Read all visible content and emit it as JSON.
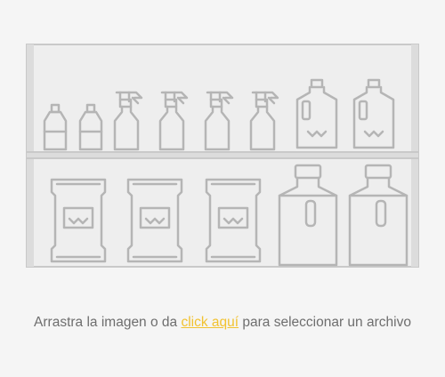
{
  "colors": {
    "background": "#f5f5f5",
    "shelf_fill": "#eeeeee",
    "shelf_stroke": "#c9c9c9",
    "product_stroke": "#b5b5b5",
    "text": "#6e6e6e",
    "link": "#f2c230"
  },
  "illustration": {
    "icon": "shelf-with-cleaning-products-icon",
    "top_shelf": {
      "small_bottles": 2,
      "spray_bottles": 4,
      "jugs": 2
    },
    "bottom_shelf": {
      "bags": 3,
      "detergent_bottles": 2
    }
  },
  "upload": {
    "text_before": "Arrastra la imagen o da ",
    "link_text": "click aquí",
    "text_after": " para seleccionar un archivo"
  }
}
